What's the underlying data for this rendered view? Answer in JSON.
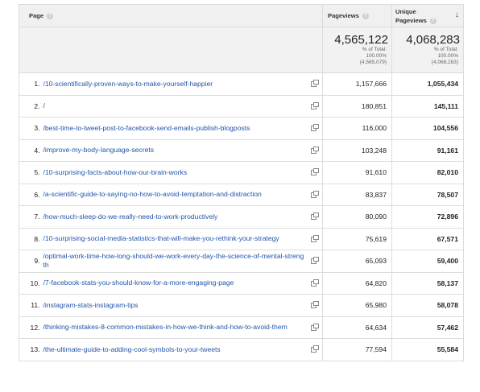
{
  "header": {
    "page_label": "Page",
    "pageviews_label": "Pageviews",
    "unique_label_line1": "Unique",
    "unique_label_line2": "Pageviews",
    "sort_icon": "arrow-down-icon"
  },
  "totals": {
    "pageviews": "4,565,122",
    "pageviews_pct": "% of Total:",
    "pageviews_pct_value": "100.00%",
    "pageviews_abs": "(4,565,079)",
    "unique": "4,068,283",
    "unique_pct": "% of Total:",
    "unique_pct_value": "100.00%",
    "unique_abs": "(4,068,283)"
  },
  "rows": [
    {
      "index": "1.",
      "page": "/10-scientifically-proven-ways-to-make-yourself-happier",
      "pageviews": "1,157,666",
      "unique": "1,055,434"
    },
    {
      "index": "2.",
      "page": "/",
      "pageviews": "180,851",
      "unique": "145,111"
    },
    {
      "index": "3.",
      "page": "/best-time-to-tweet-post-to-facebook-send-emails-publish-blogposts",
      "pageviews": "116,000",
      "unique": "104,556"
    },
    {
      "index": "4.",
      "page": "/improve-my-body-language-secrets",
      "pageviews": "103,248",
      "unique": "91,161"
    },
    {
      "index": "5.",
      "page": "/10-surprising-facts-about-how-our-brain-works",
      "pageviews": "91,610",
      "unique": "82,010"
    },
    {
      "index": "6.",
      "page": "/a-scientific-guide-to-saying-no-how-to-avoid-temptation-and-distraction",
      "pageviews": "83,837",
      "unique": "78,507"
    },
    {
      "index": "7.",
      "page": "/how-much-sleep-do-we-really-need-to-work-productively",
      "pageviews": "80,090",
      "unique": "72,896"
    },
    {
      "index": "8.",
      "page": "/10-surprising-social-media-statistics-that-will-make-you-rethink-your-strategy",
      "pageviews": "75,619",
      "unique": "67,571"
    },
    {
      "index": "9.",
      "page": "/optimal-work-time-how-long-should-we-work-every-day-the-science-of-mental-strength",
      "pageviews": "65,093",
      "unique": "59,400"
    },
    {
      "index": "10.",
      "page": "/7-facebook-stats-you-should-know-for-a-more-engaging-page",
      "pageviews": "64,820",
      "unique": "58,137"
    },
    {
      "index": "11.",
      "page": "/instagram-stats-instagram-tips",
      "pageviews": "65,980",
      "unique": "58,078"
    },
    {
      "index": "12.",
      "page": "/thinking-mistakes-8-common-mistakes-in-how-we-think-and-how-to-avoid-them",
      "pageviews": "64,634",
      "unique": "57,462"
    },
    {
      "index": "13.",
      "page": "/the-ultimate-guide-to-adding-cool-symbols-to-your-tweets",
      "pageviews": "77,594",
      "unique": "55,584"
    }
  ]
}
